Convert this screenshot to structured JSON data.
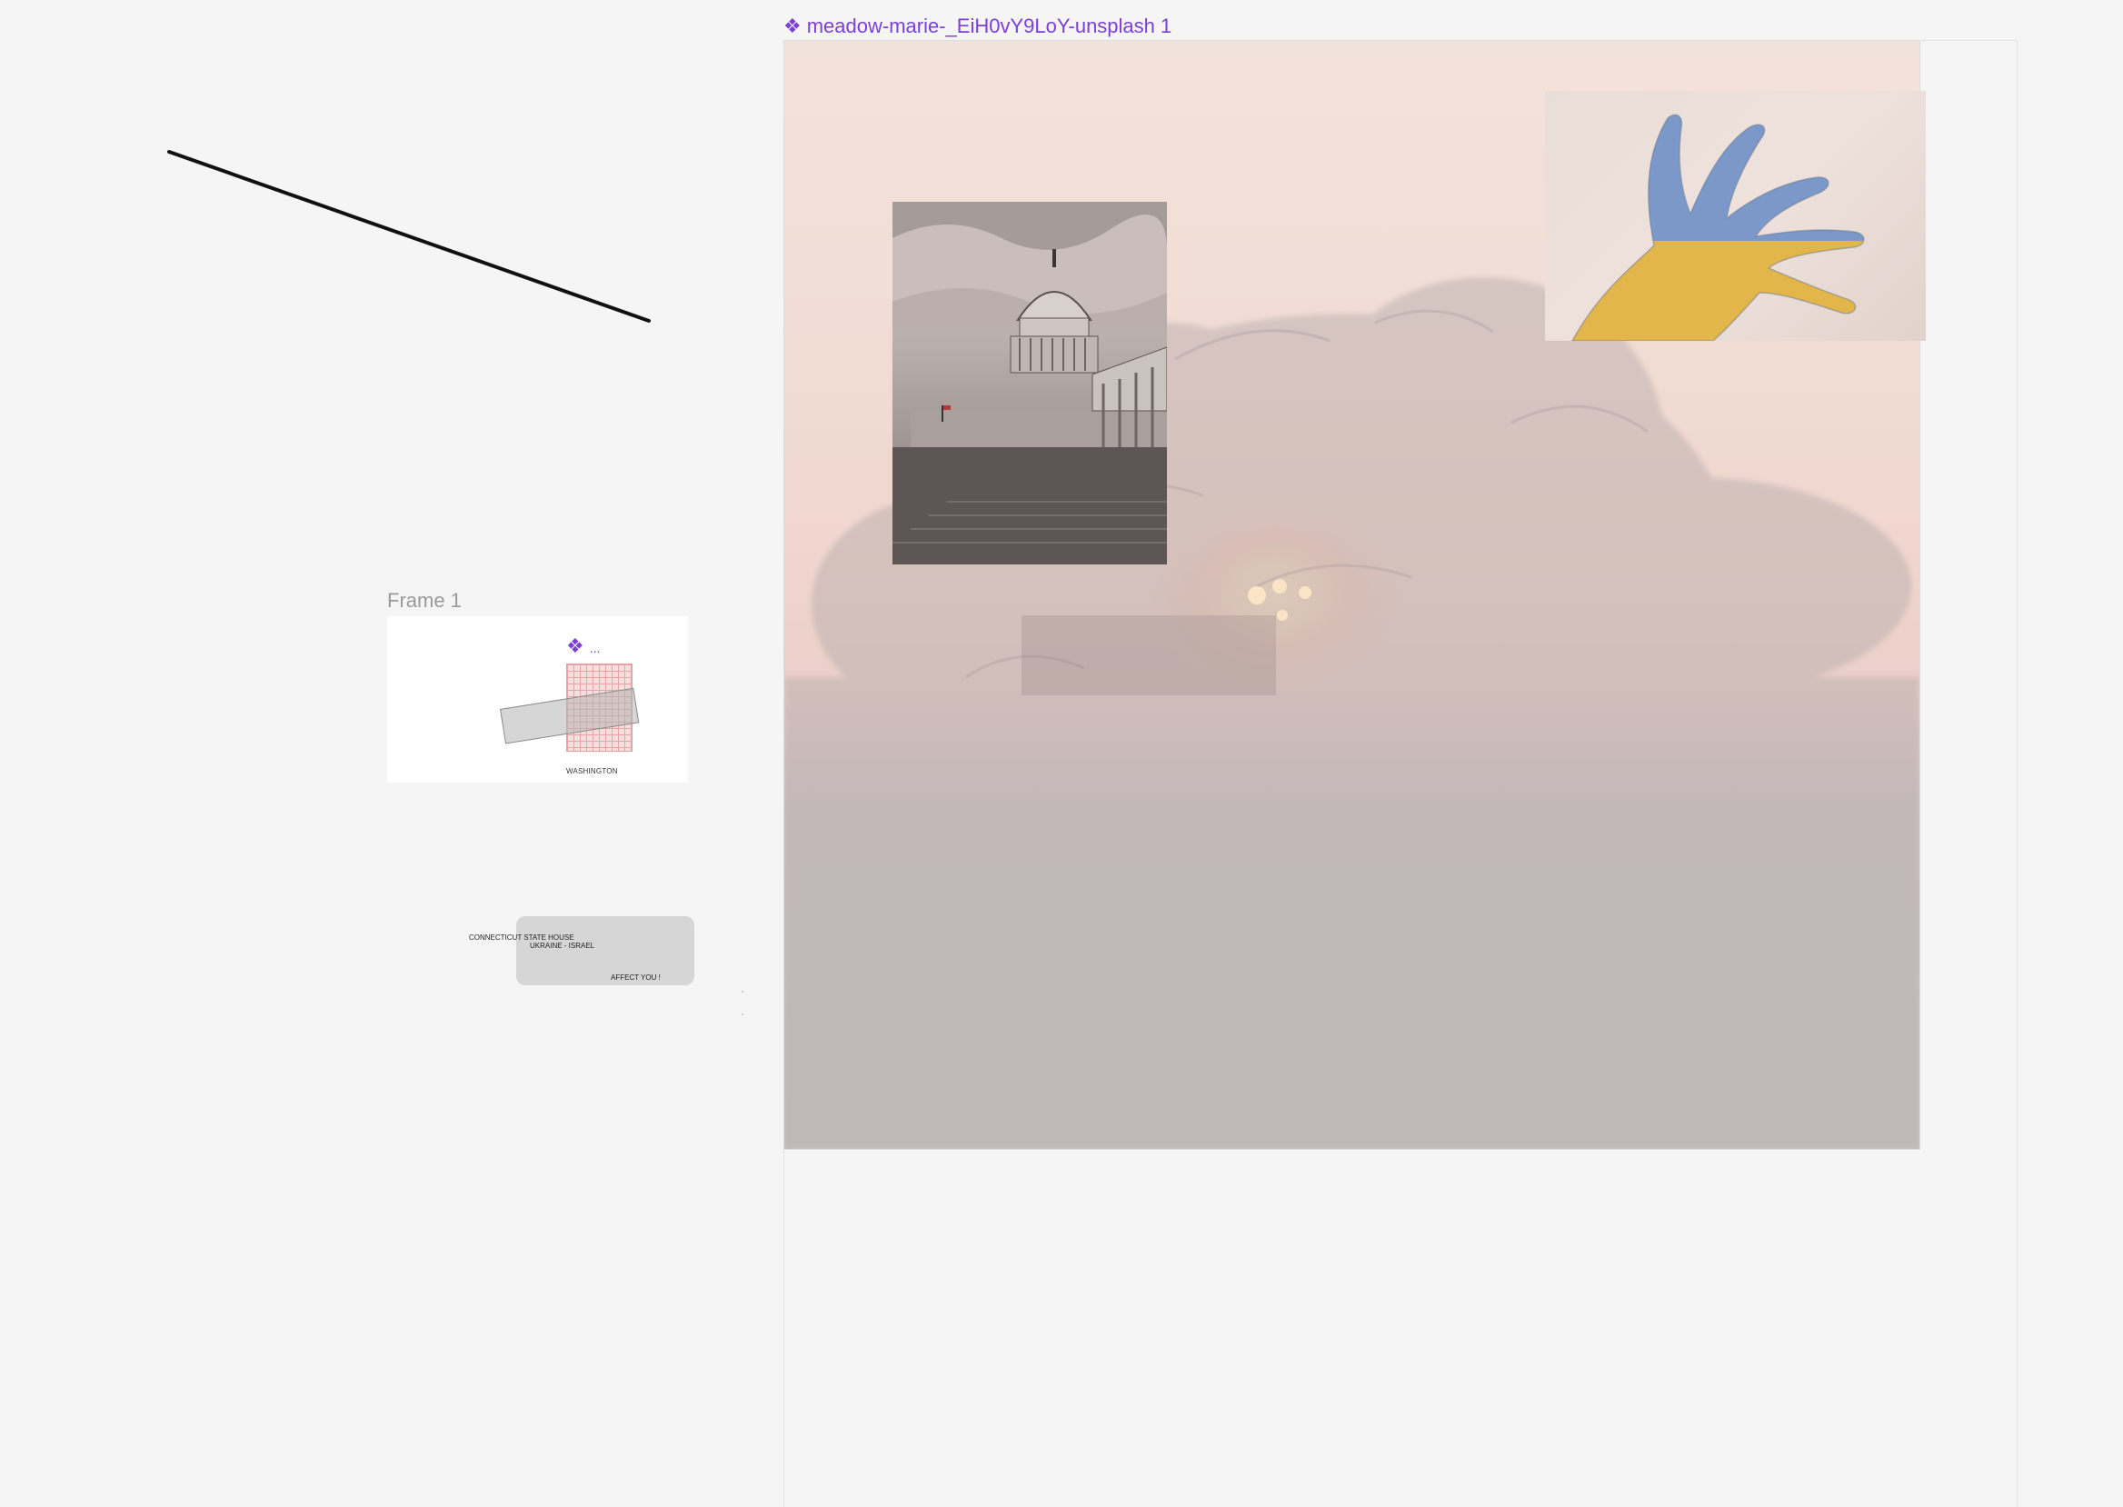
{
  "canvas": {
    "background_color": "#f5f5f5",
    "accent_color": "#7b3fd6"
  },
  "component_label": {
    "icon": "component-icon",
    "glyph": "❖",
    "text": "meadow-marie-_EiH0vY9LoY-unsplash 1"
  },
  "frame1": {
    "title": "Frame 1",
    "mini_glyph": "❖",
    "mini_label": "...",
    "caption": "WASHINGTON"
  },
  "card": {
    "line1": "CONNECTICUT STATE HOUSE",
    "line2": "UKRAINE - ISRAEL",
    "line3": "AFFECT YOU !"
  },
  "images": {
    "main": "sunset-foliage-image",
    "capitol": "capitol-building-photo",
    "hand": "ukraine-flag-hand-photo"
  }
}
